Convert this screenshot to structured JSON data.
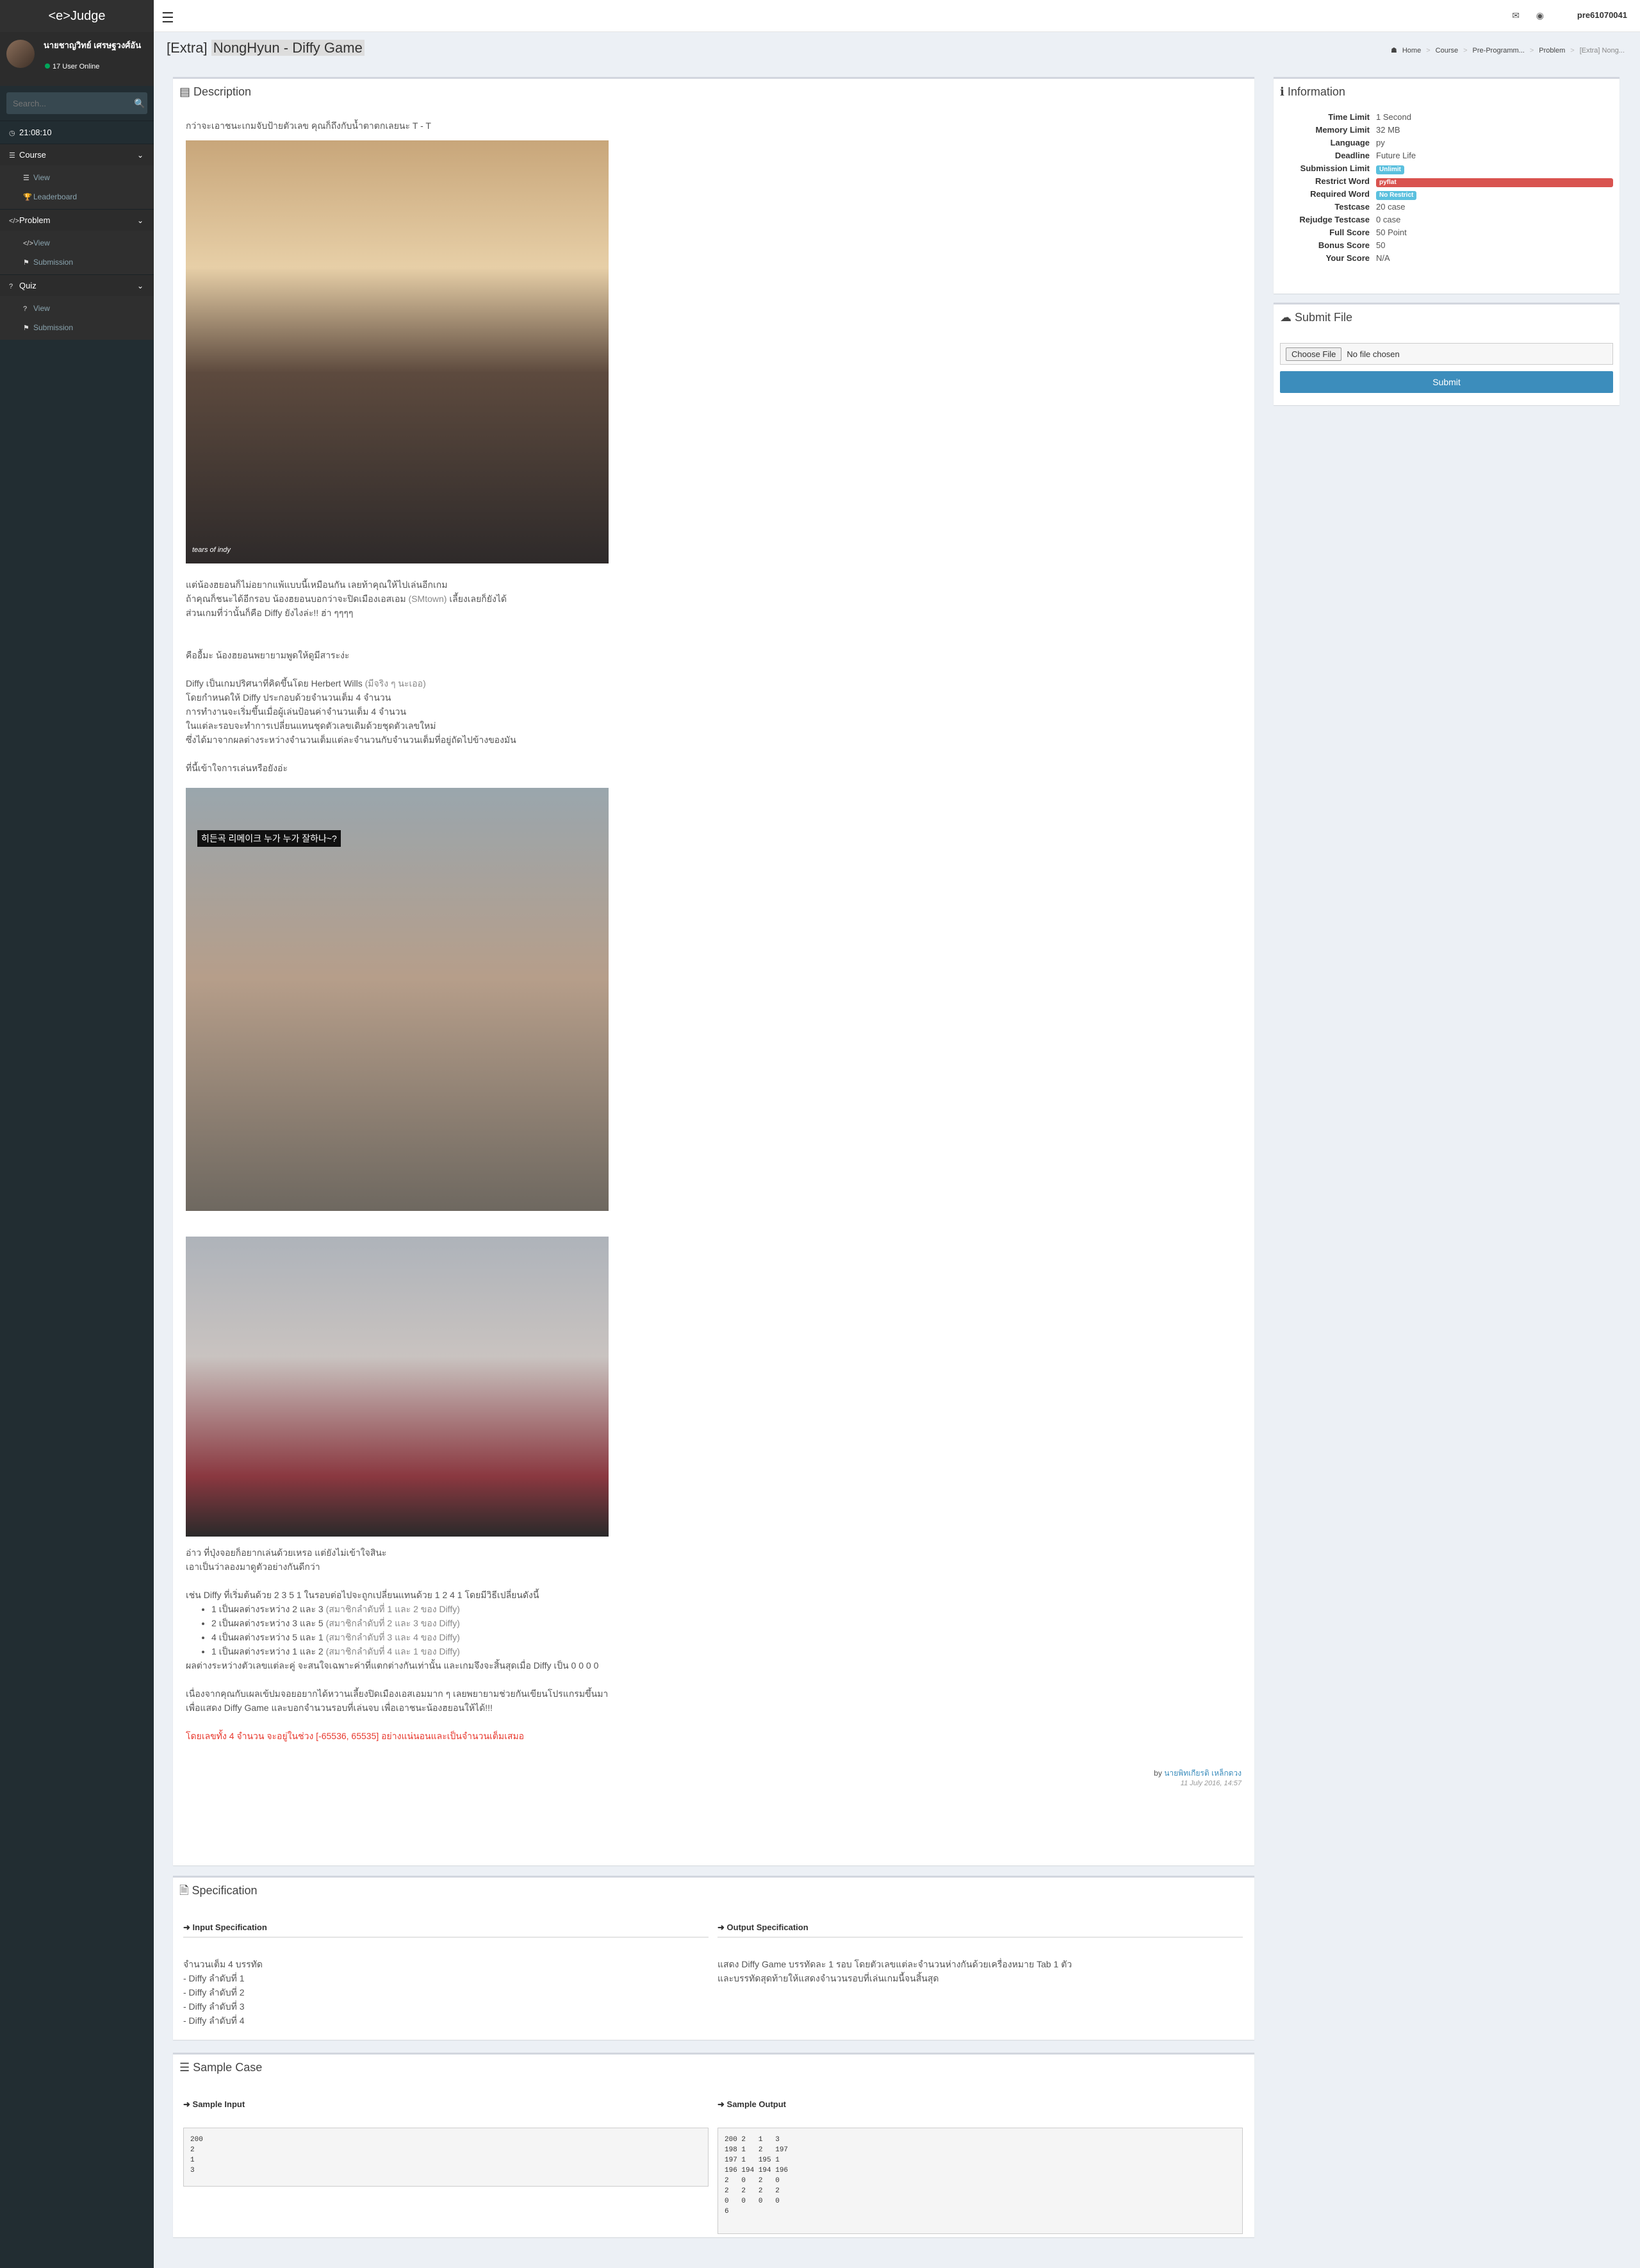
{
  "logo": "<e>Judge",
  "user": {
    "name": "นายชาญวิทย์ เศรษฐวงศ์อัน",
    "online": "17 User Online"
  },
  "sidebar": {
    "search_placeholder": "Search...",
    "clock": "21:08:10",
    "sections": [
      {
        "title": "Course",
        "items": [
          "View",
          "Leaderboard"
        ]
      },
      {
        "title": "Problem",
        "items": [
          "View",
          "Submission"
        ]
      },
      {
        "title": "Quiz",
        "items": [
          "View",
          "Submission"
        ]
      }
    ]
  },
  "topbar": {
    "username": "pre61070041"
  },
  "title": {
    "prefix": "[Extra]",
    "name": "NongHyun - Diffy Game"
  },
  "breadcrumb": [
    "Home",
    "Course",
    "Pre-Programm...",
    "Problem",
    "[Extra] Nong..."
  ],
  "description": {
    "header": "Description",
    "intro": "กว่าจะเอาชนะเกมจับป้ายตัวเลข คุณก็ถึงกับน้ำตาตกเลยนะ T - T",
    "img1_caption": "tears of indy",
    "p1": [
      "แต่น้องฮยอนก็ไม่อยากแพ้แบบนี้เหมือนกัน เลยท้าคุณให้ไปเล่นอีกเกม",
      "ถ้าคุณก็ชนะได้อีกรอบ น้องฮยอนบอกว่าจะปิดเมืองเอสเอม",
      "(SMtown)",
      "เลี้ยงเลยก็ยังได้",
      "ส่วนเกมที่ว่านั้นก็คือ Diffy ยังไงล่ะ!! ฮ่า ๆๆๆๆ"
    ],
    "p2": "คืออื้มะ น้องฮยอนพยายามพูดให้ดูมีสาระง่ะ",
    "p3": [
      "Diffy เป็นเกมปริศนาที่คิดขึ้นโดย Herbert Wills",
      "(มีจริง ๆ นะเออ)",
      "โดยกำหนดให้ Diffy ประกอบด้วยจำนวนเต็ม 4 จำนวน",
      "การทำงานจะเริ่มขึ้นเมื่อผู้เล่นป้อนค่าจำนวนเต็ม 4 จำนวน",
      "ในแต่ละรอบจะทำการเปลี่ยนแทนชุดตัวเลขเดิมด้วยชุดตัวเลขใหม่",
      "ซึ่งได้มาจากผลต่างระหว่างจำนวนเต็มแต่ละจำนวนกับจำนวนเต็มที่อยู่ถัดไปข้างของมัน"
    ],
    "p4": "ที่นี้เข้าใจการเล่นหรือยังอ่ะ",
    "img2_caption": "히든곡 리메이크 누가 누가 잘하나~?",
    "p5": [
      "อ่าว ที่ปุ่งจอยก็อยากเล่นด้วยเหรอ แต่ยังไม่เข้าใจสินะ",
      "เอาเป็นว่าลองมาดูตัวอย่างกันดีกว่า"
    ],
    "example": "เช่น Diffy ที่เริ่มต้นด้วย 2 3 5 1 ในรอบต่อไปจะถูกเปลี่ยนแทนด้วย 1 2 4 1 โดยมีวิธีเปลี่ยนดังนี้",
    "bullets": [
      {
        "t": "1 เป็นผลต่างระหว่าง 2 และ 3",
        "g": "(สมาชิกลำดับที่ 1 และ 2 ของ Diffy)"
      },
      {
        "t": "2 เป็นผลต่างระหว่าง 3 และ 5",
        "g": "(สมาชิกลำดับที่ 2 และ 3 ของ Diffy)"
      },
      {
        "t": "4 เป็นผลต่างระหว่าง 5 และ 1",
        "g": "(สมาชิกลำดับที่ 3 และ 4 ของ Diffy)"
      },
      {
        "t": "1 เป็นผลต่างระหว่าง 1 และ 2",
        "g": "(สมาชิกลำดับที่ 4 และ 1 ของ Diffy)"
      }
    ],
    "p6": "ผลต่างระหว่างตัวเลขแต่ละคู่ จะสนใจเฉพาะค่าที่แตกต่างกันเท่านั้น และเกมจึงจะสิ้นสุดเมื่อ Diffy เป็น 0 0 0 0",
    "p7": [
      "เนื่องจากคุณกับเผลเข้ปมจอยอยากได้หวานเลี้ยงปิดเมืองเอสเอมมาก ๆ เลยพยายามช่วยกันเขียนโปรแกรมขึ้นมา",
      "เพื่อแสดง Diffy Game และบอกจำนวนรอบที่เล่นจบ เพื่อเอาชนะน้องฮยอนให้ได้!!!"
    ],
    "note": "โดยเลขทั้ง 4 จำนวน จะอยู่ในช่วง [-65536, 65535] อย่างแน่นอนและเป็นจำนวนเต็มเสมอ",
    "by": "by",
    "author": "นายพิทเกียรติ เหล็กดวง",
    "date": "11 July 2016, 14:57"
  },
  "info": {
    "header": "Information",
    "rows": [
      {
        "k": "Time Limit",
        "v": "1 Second"
      },
      {
        "k": "Memory Limit",
        "v": "32 MB"
      },
      {
        "k": "Language",
        "v": "py"
      },
      {
        "k": "Deadline",
        "v": "Future Life"
      }
    ],
    "submission_limit_k": "Submission Limit",
    "submission_limit_v": "Unlimit",
    "restrict_word_k": "Restrict Word",
    "restrict_word_v": "pyflat",
    "required_word_k": "Required Word",
    "required_word_v": "No Restrict",
    "rows2": [
      {
        "k": "Testcase",
        "v": "20 case"
      },
      {
        "k": "Rejudge Testcase",
        "v": "0 case"
      },
      {
        "k": "Full Score",
        "v": "50 Point"
      },
      {
        "k": "Bonus Score",
        "v": "50"
      },
      {
        "k": "Your Score",
        "v": "N/A"
      }
    ]
  },
  "submit": {
    "header": "Submit File",
    "choose": "Choose File",
    "no_file": "No file chosen",
    "button": "Submit"
  },
  "spec": {
    "header": "Specification",
    "input_h": "Input Specification",
    "input_lines": [
      "จำนวนเต็ม 4 บรรทัด",
      "- Diffy ลำดับที่ 1",
      "- Diffy ลำดับที่ 2",
      "- Diffy ลำดับที่ 3",
      "- Diffy ลำดับที่ 4"
    ],
    "output_h": "Output Specification",
    "output_lines": [
      "แสดง Diffy Game บรรทัดละ 1 รอบ โดยตัวเลขแต่ละจำนวนห่างกันด้วยเครื่องหมาย Tab 1 ตัว",
      "และบรรทัดสุดท้ายให้แสดงจำนวนรอบที่เล่นเกมนี้จนสิ้นสุด"
    ]
  },
  "sample": {
    "header": "Sample Case",
    "input_h": "Sample Input",
    "input": "200\n2\n1\n3",
    "output_h": "Sample Output",
    "output": "200\t2\t1\t3\n198\t1\t2\t197\n197\t1\t195\t1\n196\t194\t194\t196\n2\t0\t2\t0\n2\t2\t2\t2\n0\t0\t0\t0\n6"
  }
}
